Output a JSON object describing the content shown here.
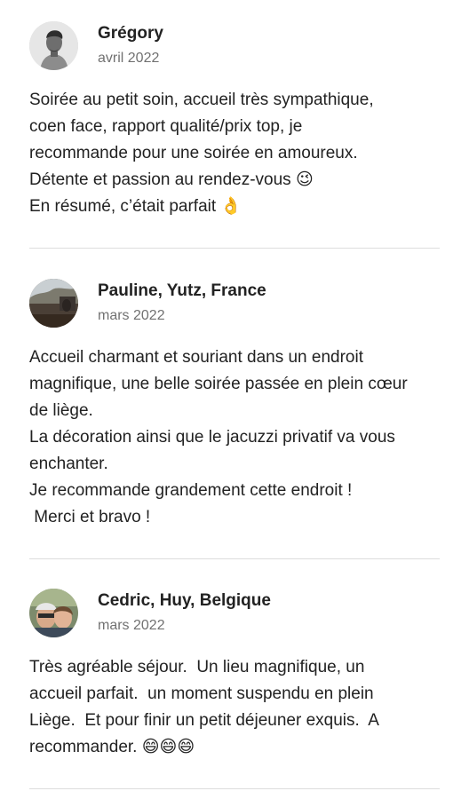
{
  "reviews": [
    {
      "name": "Grégory",
      "date": "avril 2022",
      "avatar_icon": "man-portrait-avatar",
      "text": "Soirée au petit soin, accueil très sympathique,\ncoen face, rapport qualité/prix top, je\nrecommande pour une soirée en amoureux.\nDétente et passion au rendez-vous 😉\nEn résumé, c’était parfait 👌"
    },
    {
      "name": "Pauline, Yutz, France",
      "date": "mars 2022",
      "avatar_icon": "landscape-photo-avatar",
      "text": "Accueil charmant et souriant dans un endroit\nmagnifique, une belle soirée passée en plein cœur\nde liège.\nLa décoration ainsi que le jacuzzi privatif va vous\nenchanter.\nJe recommande grandement cette endroit !\n Merci et bravo !"
    },
    {
      "name": "Cedric, Huy, Belgique",
      "date": "mars 2022",
      "avatar_icon": "couple-photo-avatar",
      "text": "Très agréable séjour.  Un lieu magnifique, un\naccueil parfait.  un moment suspendu en plein\nLiège.  Et pour finir un petit déjeuner exquis.  A\nrecommander. 😄😄😄"
    }
  ],
  "colors": {
    "text": "#222222",
    "secondary_text": "#717171",
    "divider": "#dddddd"
  }
}
